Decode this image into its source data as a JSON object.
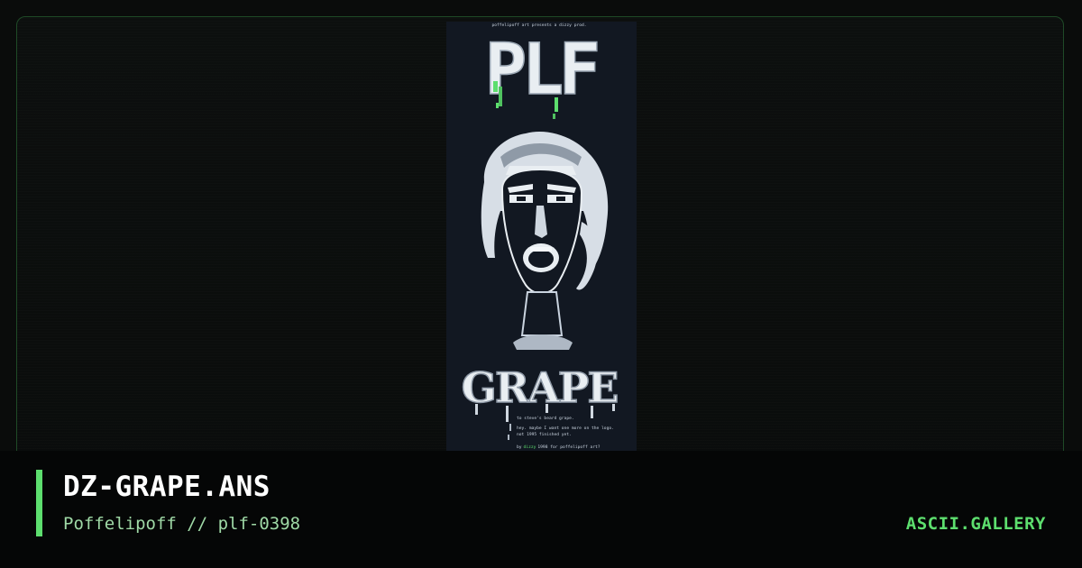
{
  "artwork": {
    "logo_text": "PLF",
    "grape_text": "GRAPE",
    "header_line": "poffelipoff art presents a dizzy prod.",
    "note_line_1": "to steve's beard grape.",
    "note_line_2": "hey. maybe I want one more on the logo.",
    "note_line_3": "not 1995 finished yet.",
    "credit_prefix": "by",
    "credit_name": "dizzy",
    "credit_suffix": "1998 for poffelipoff art?"
  },
  "caption": {
    "title": "DZ-GRAPE.ANS",
    "subtitle": "Poffelipoff // plf-0398",
    "brand": "ASCII.GALLERY"
  },
  "colors": {
    "accent": "#5dde6e",
    "frame_border": "#1f4a27",
    "art_background": "#121822"
  }
}
